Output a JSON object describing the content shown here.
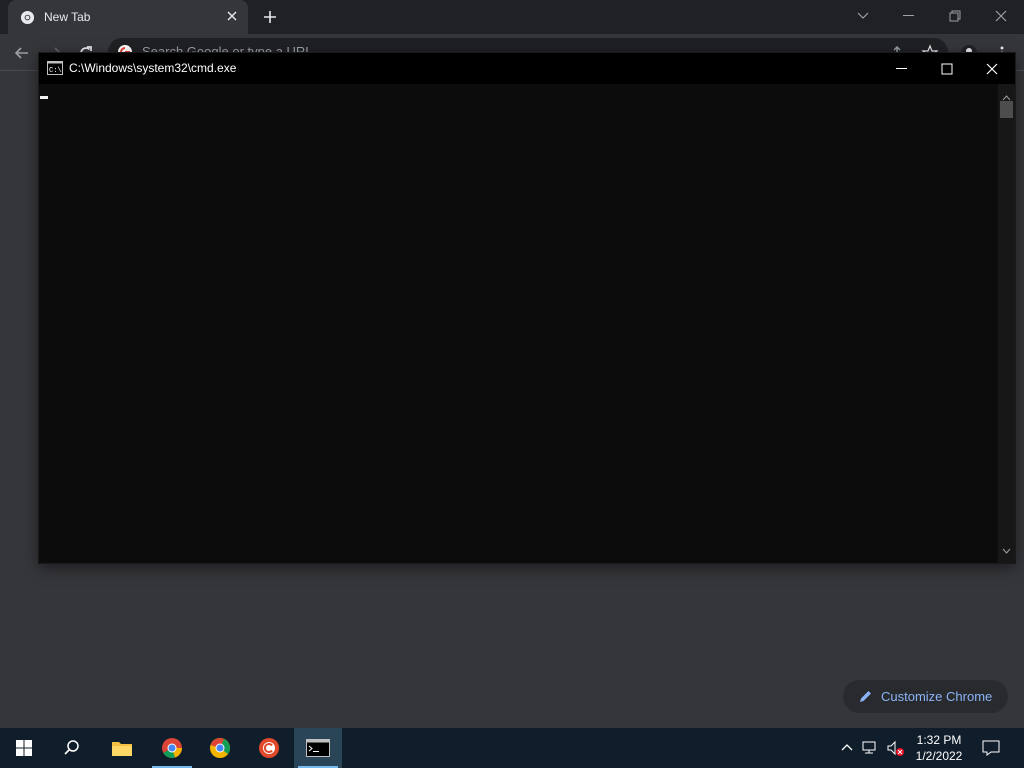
{
  "browser": {
    "tab_title": "New Tab",
    "omnibox_placeholder": "Search Google or type a URL",
    "customize_label": "Customize Chrome"
  },
  "cmd_window": {
    "title": "C:\\Windows\\system32\\cmd.exe",
    "title_icon_text": "C:\\"
  },
  "taskbar": {
    "apps": [
      "start-icon",
      "search-icon",
      "file-explorer-icon",
      "chrome-icon",
      "chrome-alt-icon",
      "ccleaner-icon",
      "cmd-icon"
    ],
    "time": "1:32 PM",
    "date": "1/2/2022"
  },
  "colors": {
    "chrome_dark": "#202124",
    "chrome_surface": "#35363a",
    "cmd_bg": "#0c0c0c",
    "accent_blue": "#8ab4f8",
    "taskbar": "#101d2a"
  }
}
